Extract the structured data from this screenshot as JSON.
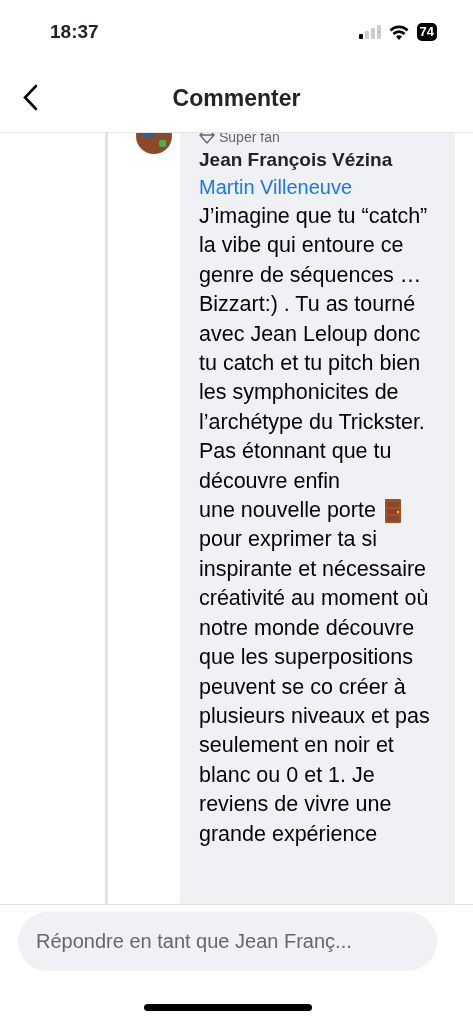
{
  "status_bar": {
    "time": "18:37",
    "battery": "74"
  },
  "header": {
    "title": "Commenter"
  },
  "comment": {
    "badge": "Super fan",
    "author": "Jean François Vézina",
    "mention": "Martin Villeneuve",
    "text_before": "J’imagine que tu “catch” la vibe qui entoure ce genre de séquences …Bizzart:) . Tu as tourné avec Jean Leloup donc tu catch et tu pitch bien les symphonicites de l’archétype du Trickster. Pas étonnant que tu découvre enfin",
    "door_line": "une nouvelle porte",
    "text_after": "pour exprimer ta si inspirante et nécessaire créativité au moment où notre monde découvre que les superpositions peuvent se co créer à plusieurs niveaux et pas seulement en noir et blanc ou 0 et 1. Je reviens de vivre une grande expérience"
  },
  "reply": {
    "placeholder": "Répondre en tant que Jean Franç..."
  }
}
